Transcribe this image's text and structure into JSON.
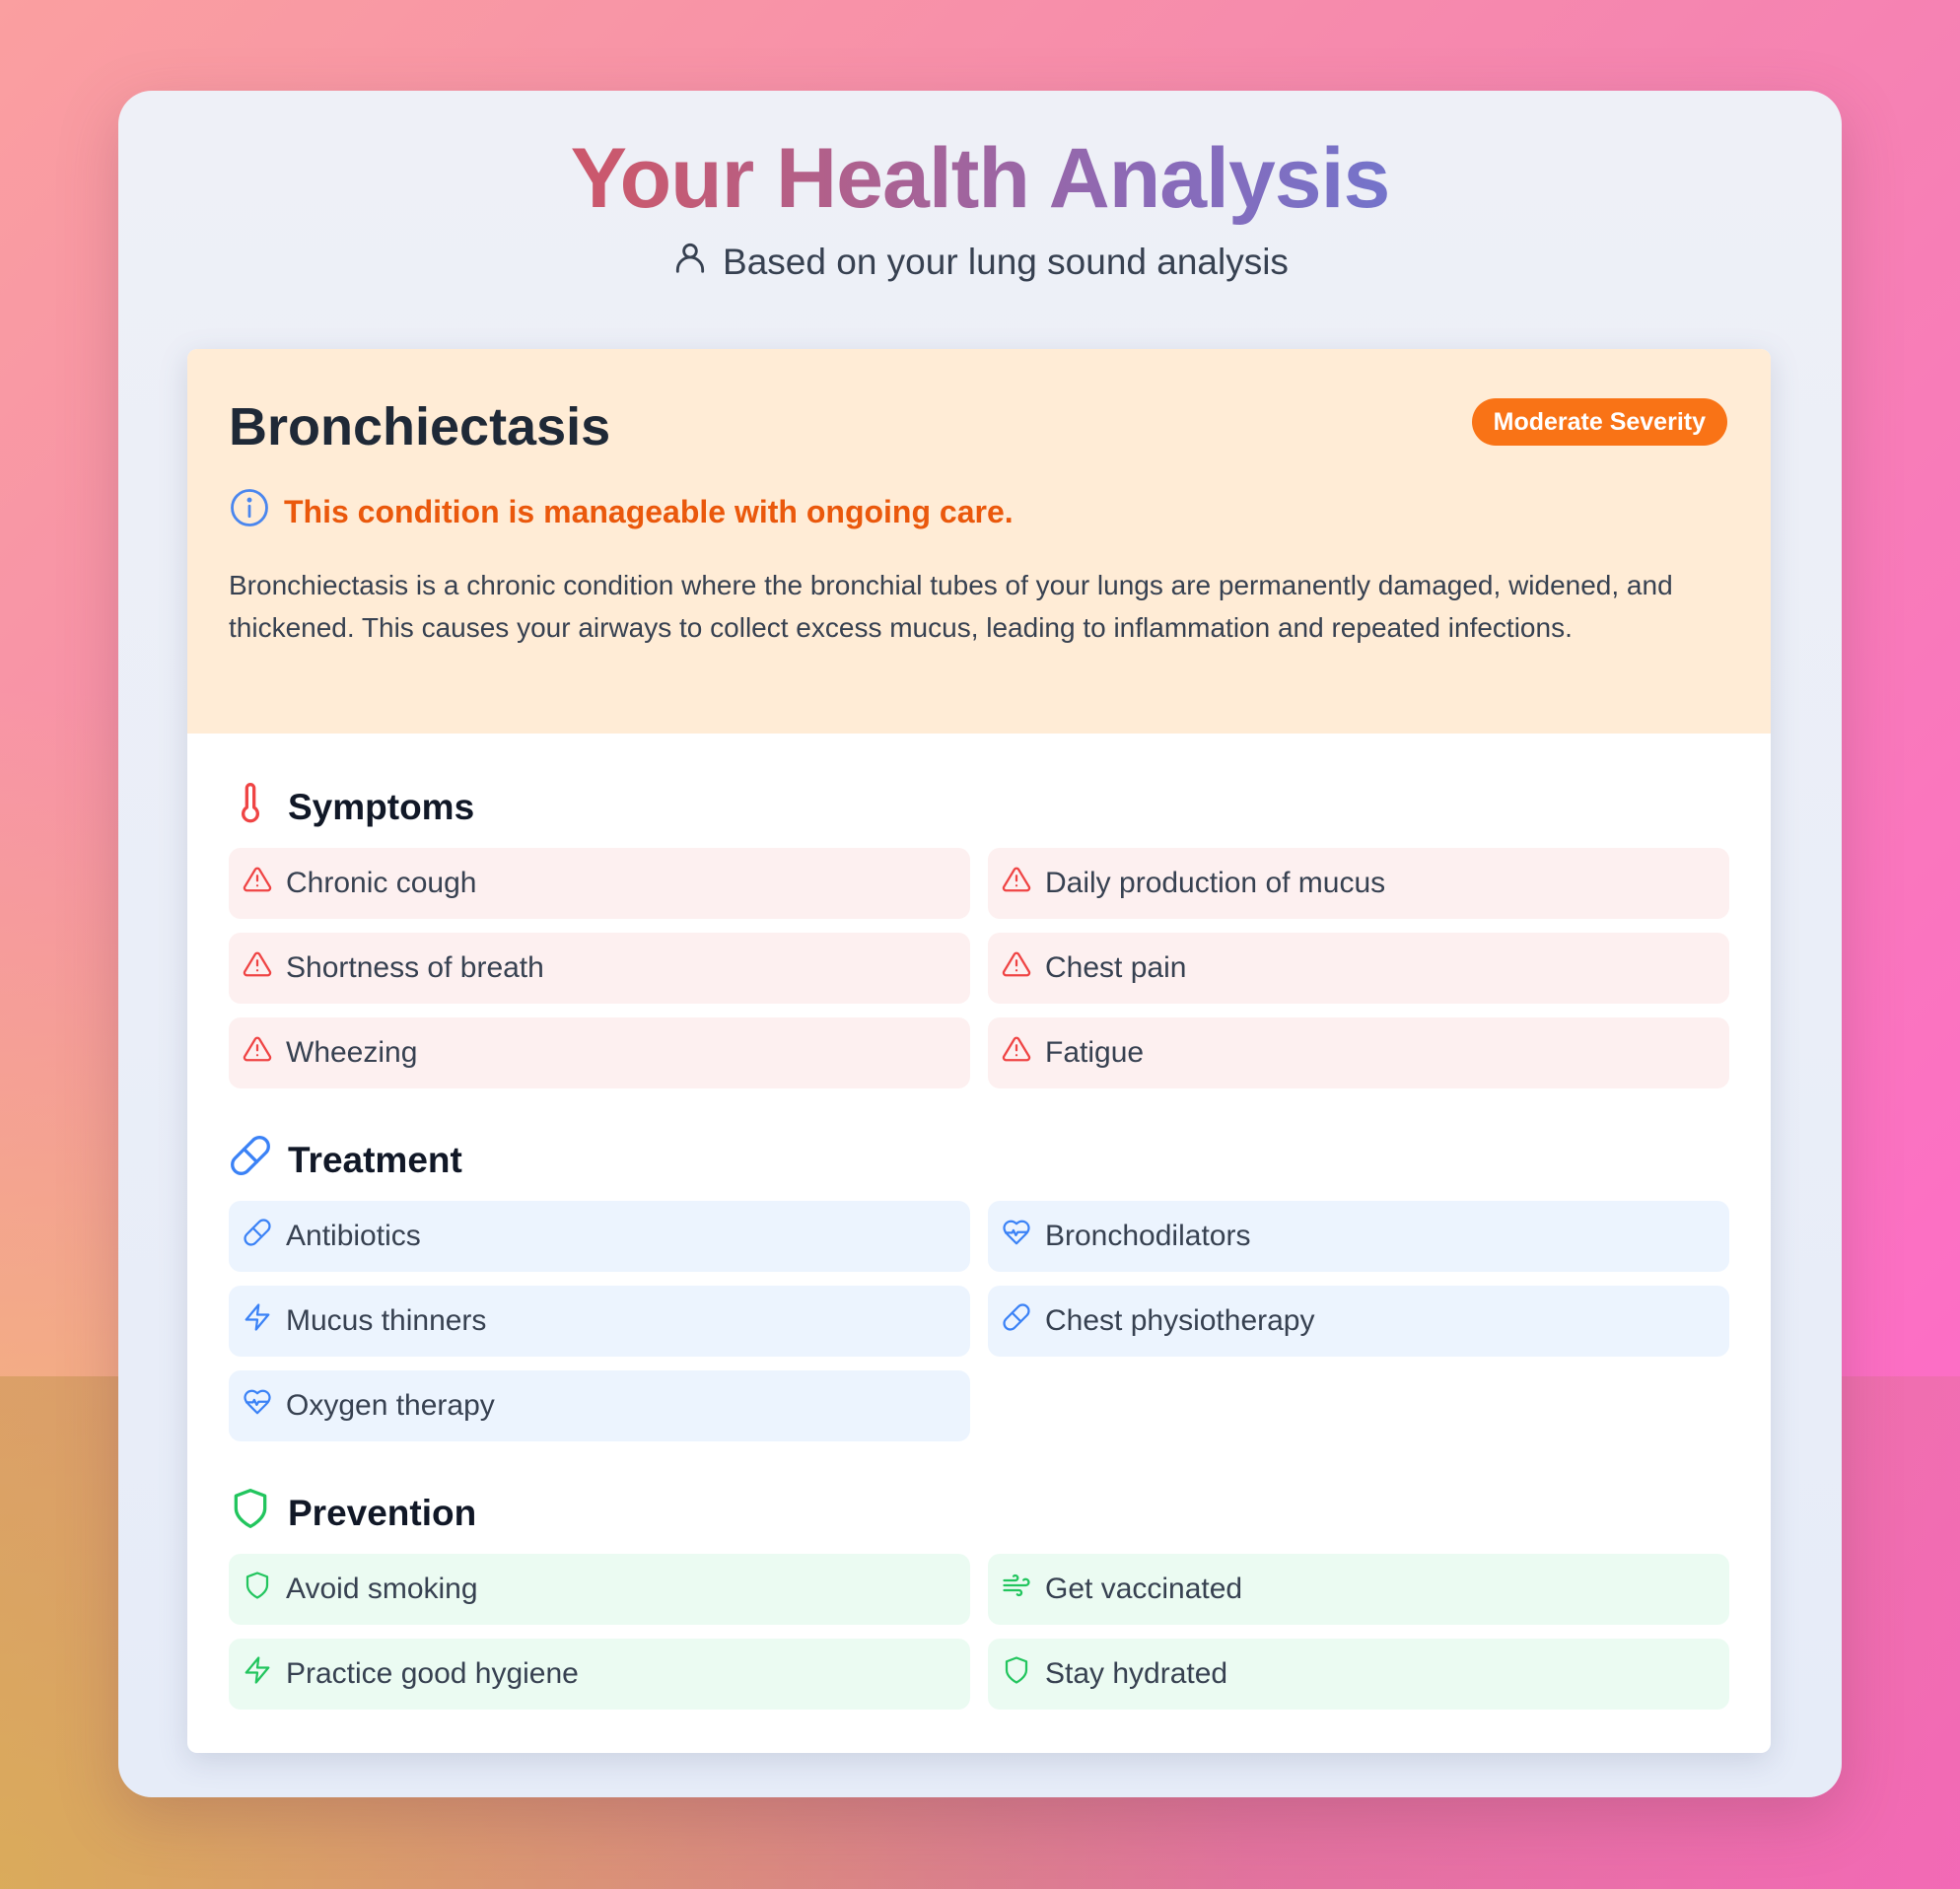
{
  "header": {
    "title": "Your Health Analysis",
    "subtitle": "Based on your lung sound analysis"
  },
  "condition": {
    "name": "Bronchiectasis",
    "severity": "Moderate Severity",
    "note": "This condition is manageable with ongoing care.",
    "description": "Bronchiectasis is a chronic condition where the bronchial tubes of your lungs are permanently damaged, widened, and thickened. This causes your airways to collect excess mucus, leading to inflammation and repeated infections."
  },
  "symptoms": {
    "title": "Symptoms",
    "items": [
      {
        "label": "Chronic cough",
        "icon": "warning-icon"
      },
      {
        "label": "Daily production of mucus",
        "icon": "warning-icon"
      },
      {
        "label": "Shortness of breath",
        "icon": "warning-icon"
      },
      {
        "label": "Chest pain",
        "icon": "warning-icon"
      },
      {
        "label": "Wheezing",
        "icon": "warning-icon"
      },
      {
        "label": "Fatigue",
        "icon": "warning-icon"
      }
    ]
  },
  "treatment": {
    "title": "Treatment",
    "items": [
      {
        "label": "Antibiotics",
        "icon": "pill-icon"
      },
      {
        "label": "Bronchodilators",
        "icon": "heart-pulse-icon"
      },
      {
        "label": "Mucus thinners",
        "icon": "lightning-icon"
      },
      {
        "label": "Chest physiotherapy",
        "icon": "pill-icon"
      },
      {
        "label": "Oxygen therapy",
        "icon": "heart-pulse-icon"
      }
    ]
  },
  "prevention": {
    "title": "Prevention",
    "items": [
      {
        "label": "Avoid smoking",
        "icon": "shield-icon"
      },
      {
        "label": "Get vaccinated",
        "icon": "wind-icon"
      },
      {
        "label": "Practice good hygiene",
        "icon": "lightning-icon"
      },
      {
        "label": "Stay hydrated",
        "icon": "shield-icon"
      }
    ]
  },
  "colors": {
    "symptom_accent": "#ef4444",
    "treatment_accent": "#3b82f6",
    "prevention_accent": "#22c55e",
    "severity_badge": "#f97316"
  }
}
